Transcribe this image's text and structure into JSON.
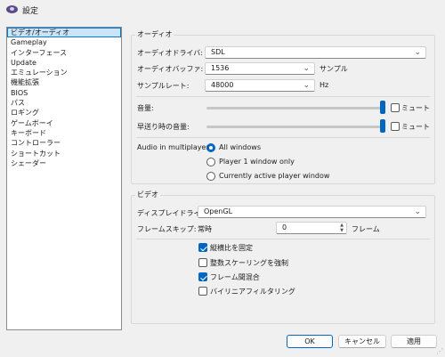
{
  "window": {
    "title": "設定"
  },
  "sidebar": {
    "items": [
      {
        "label": "ビデオ/オーディオ",
        "selected": true
      },
      {
        "label": "Gameplay"
      },
      {
        "label": "インターフェース"
      },
      {
        "label": "Update"
      },
      {
        "label": "エミュレーション"
      },
      {
        "label": "機能拡張"
      },
      {
        "label": "BIOS"
      },
      {
        "label": "パス"
      },
      {
        "label": "ロギング"
      },
      {
        "label": "ゲームボーイ"
      },
      {
        "label": "キーボード"
      },
      {
        "label": "コントローラー"
      },
      {
        "label": "ショートカット"
      },
      {
        "label": "シェーダー"
      }
    ]
  },
  "audio": {
    "title": "オーディオ",
    "driver_label": "オーディオドライバ:",
    "driver_value": "SDL",
    "buffer_label": "オーディオバッファ:",
    "buffer_value": "1536",
    "buffer_unit": "サンプル",
    "samplerate_label": "サンプルレート:",
    "samplerate_value": "48000",
    "samplerate_unit": "Hz",
    "volume_label": "音量:",
    "volume_level": 1.0,
    "ff_volume_label": "早送り時の音量:",
    "ff_volume_level": 1.0,
    "mute_label": "ミュート",
    "multiplayer_label": "Audio in multiplayer:",
    "multiplayer_options": [
      "All windows",
      "Player 1 window only",
      "Currently active player window"
    ],
    "multiplayer_selected": 0
  },
  "video": {
    "title": "ビデオ",
    "display_driver_label": "ディスプレイドライバ:",
    "display_driver_value": "OpenGL",
    "frameskip_label": "フレームスキップ:",
    "frameskip_prefix": "常時",
    "frameskip_value": "0",
    "frameskip_unit": "フレーム",
    "options": [
      {
        "label": "縦横比を固定",
        "checked": true
      },
      {
        "label": "整数スケーリングを強制",
        "checked": false
      },
      {
        "label": "フレーム間混合",
        "checked": true
      },
      {
        "label": "バイリニアフィルタリング",
        "checked": false
      }
    ]
  },
  "buttons": {
    "ok": "OK",
    "cancel": "キャンセル",
    "apply": "適用"
  },
  "colors": {
    "accent": "#0067c0",
    "selection": "#cce4f7"
  }
}
